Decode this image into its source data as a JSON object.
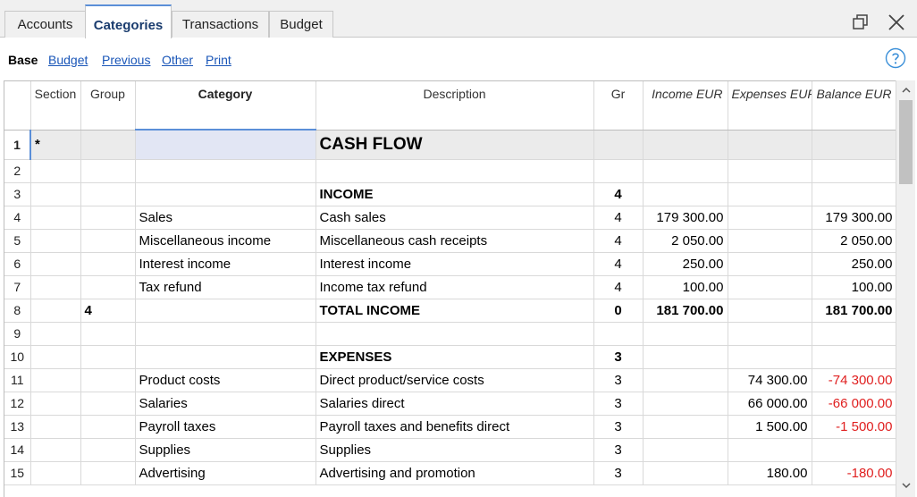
{
  "tabs": [
    {
      "label": "Accounts"
    },
    {
      "label": "Categories"
    },
    {
      "label": "Transactions"
    },
    {
      "label": "Budget"
    }
  ],
  "views": [
    "Base",
    "Budget",
    "Previous",
    "Other",
    "Print"
  ],
  "columns": {
    "section": "Section",
    "group": "Group",
    "category": "Category",
    "description": "Description",
    "gr": "Gr",
    "income": "Income EUR",
    "expenses": "Expenses EUR",
    "balance": "Balance EUR"
  },
  "rows": [
    {
      "n": "1",
      "section": "*",
      "group": "",
      "category": "",
      "description": "CASH FLOW",
      "gr": "",
      "income": "",
      "expenses": "",
      "balance": ""
    },
    {
      "n": "2",
      "section": "",
      "group": "",
      "category": "",
      "description": "",
      "gr": "",
      "income": "",
      "expenses": "",
      "balance": ""
    },
    {
      "n": "3",
      "section": "",
      "group": "",
      "category": "",
      "description": "INCOME",
      "gr": "4",
      "income": "",
      "expenses": "",
      "balance": ""
    },
    {
      "n": "4",
      "section": "",
      "group": "",
      "category": "Sales",
      "description": "Cash sales",
      "gr": "4",
      "income": "179 300.00",
      "expenses": "",
      "balance": "179 300.00"
    },
    {
      "n": "5",
      "section": "",
      "group": "",
      "category": "Miscellaneous income",
      "description": "Miscellaneous cash receipts",
      "gr": "4",
      "income": "2 050.00",
      "expenses": "",
      "balance": "2 050.00"
    },
    {
      "n": "6",
      "section": "",
      "group": "",
      "category": "Interest income",
      "description": "Interest income",
      "gr": "4",
      "income": "250.00",
      "expenses": "",
      "balance": "250.00"
    },
    {
      "n": "7",
      "section": "",
      "group": "",
      "category": "Tax refund",
      "description": "Income tax refund",
      "gr": "4",
      "income": "100.00",
      "expenses": "",
      "balance": "100.00"
    },
    {
      "n": "8",
      "section": "",
      "group": "4",
      "category": "",
      "description": "TOTAL INCOME",
      "gr": "0",
      "income": "181 700.00",
      "expenses": "",
      "balance": "181 700.00"
    },
    {
      "n": "9",
      "section": "",
      "group": "",
      "category": "",
      "description": "",
      "gr": "",
      "income": "",
      "expenses": "",
      "balance": ""
    },
    {
      "n": "10",
      "section": "",
      "group": "",
      "category": "",
      "description": "EXPENSES",
      "gr": "3",
      "income": "",
      "expenses": "",
      "balance": ""
    },
    {
      "n": "11",
      "section": "",
      "group": "",
      "category": "Product costs",
      "description": "Direct product/service costs",
      "gr": "3",
      "income": "",
      "expenses": "74 300.00",
      "balance": "-74 300.00"
    },
    {
      "n": "12",
      "section": "",
      "group": "",
      "category": "Salaries",
      "description": "Salaries direct",
      "gr": "3",
      "income": "",
      "expenses": "66 000.00",
      "balance": "-66 000.00"
    },
    {
      "n": "13",
      "section": "",
      "group": "",
      "category": "Payroll taxes",
      "description": "Payroll taxes and benefits direct",
      "gr": "3",
      "income": "",
      "expenses": "1 500.00",
      "balance": "-1 500.00"
    },
    {
      "n": "14",
      "section": "",
      "group": "",
      "category": "Supplies",
      "description": "Supplies",
      "gr": "3",
      "income": "",
      "expenses": "",
      "balance": ""
    },
    {
      "n": "15",
      "section": "",
      "group": "",
      "category": "Advertising",
      "description": "Advertising and promotion",
      "gr": "3",
      "income": "",
      "expenses": "180.00",
      "balance": "-180.00"
    }
  ],
  "colors": {
    "accent": "#5b8fd8",
    "negative": "#e02020",
    "link": "#1a56b8"
  },
  "icons": {
    "restore": "restore-window-icon",
    "close": "close-icon",
    "help": "help-icon",
    "scroll_up": "chevron-up-icon",
    "scroll_down": "chevron-down-icon"
  }
}
